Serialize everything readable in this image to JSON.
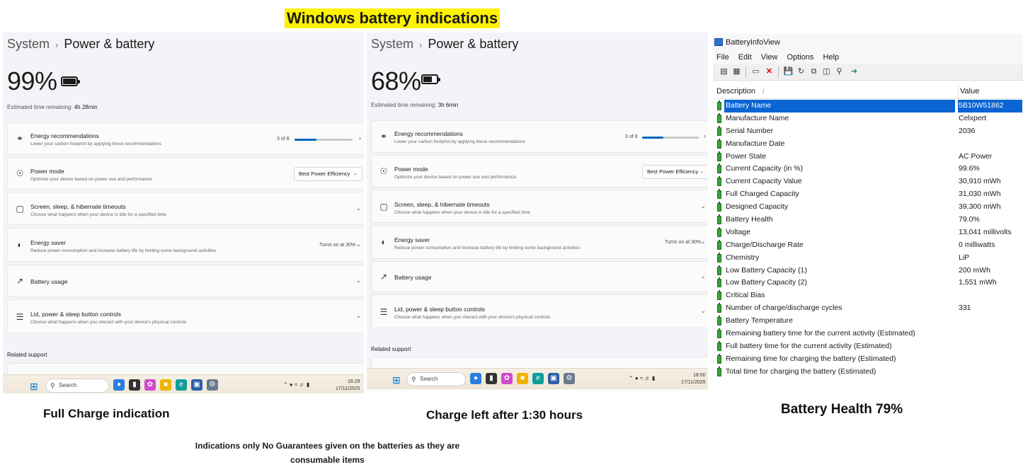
{
  "banner": "Windows battery indications",
  "panels": [
    {
      "breadcrumb_parent": "System",
      "breadcrumb_current": "Power & battery",
      "percentage": "99%",
      "battery_level": 0.99,
      "estimate_label": "Estimated time remaining:",
      "estimate_value": "4h 28min",
      "energy_title": "Energy recommendations",
      "energy_desc": "Lower your carbon footprint by applying these recommendations",
      "energy_count": "3 of 8",
      "energy_progress": 0.375,
      "power_mode_title": "Power mode",
      "power_mode_desc": "Optimize your device based on power use and performance",
      "power_mode_value": "Best Power Efficiency",
      "screen_title": "Screen, sleep, & hibernate timeouts",
      "screen_desc": "Choose what happens when your device is idle for a specified time",
      "saver_title": "Energy saver",
      "saver_desc": "Reduce power consumption and increase battery life by limiting some background activities",
      "saver_value": "Turns on at 30%",
      "usage_title": "Battery usage",
      "lid_title": "Lid, power & sleep button controls",
      "lid_desc": "Choose what happens when you interact with your device's physical controls",
      "related": "Related support",
      "search": "Search",
      "time": "16:29",
      "date": "17/11/2025"
    },
    {
      "breadcrumb_parent": "System",
      "breadcrumb_current": "Power & battery",
      "percentage": "68%",
      "battery_level": 0.68,
      "estimate_label": "Estimated time remaining:",
      "estimate_value": "3h 6min",
      "energy_title": "Energy recommendations",
      "energy_desc": "Lower your carbon footprint by applying these recommendations",
      "energy_count": "3 of 8",
      "energy_progress": 0.375,
      "power_mode_title": "Power mode",
      "power_mode_desc": "Optimize your device based on power use and performance",
      "power_mode_value": "Best Power Efficiency",
      "screen_title": "Screen, sleep, & hibernate timeouts",
      "screen_desc": "Choose what happens when your device is idle for a specified time",
      "saver_title": "Energy saver",
      "saver_desc": "Reduce power consumption and increase battery life by limiting some background activities",
      "saver_value": "Turns on at 30%",
      "usage_title": "Battery usage",
      "lid_title": "Lid, power & sleep button controls",
      "lid_desc": "Choose what happens when you interact with your device's physical controls",
      "related": "Related support",
      "search": "Search",
      "time": "18:00",
      "date": "17/11/2025"
    }
  ],
  "biv": {
    "title": "BatteryInfoView",
    "menu": [
      "File",
      "Edit",
      "View",
      "Options",
      "Help"
    ],
    "col_description": "Description",
    "col_value": "Value",
    "rows": [
      {
        "d": "Battery Name",
        "v": "5B10W51862"
      },
      {
        "d": "Manufacture Name",
        "v": "Celxpert"
      },
      {
        "d": "Serial Number",
        "v": " 2036"
      },
      {
        "d": "Manufacture Date",
        "v": ""
      },
      {
        "d": "Power State",
        "v": "AC Power"
      },
      {
        "d": "Current Capacity (in %)",
        "v": "99.6%"
      },
      {
        "d": "Current Capacity Value",
        "v": "30,910 mWh"
      },
      {
        "d": "Full Charged Capacity",
        "v": "31,030 mWh"
      },
      {
        "d": "Designed Capacity",
        "v": "39,300 mWh"
      },
      {
        "d": "Battery Health",
        "v": "79.0%"
      },
      {
        "d": "Voltage",
        "v": "13,041 millivolts"
      },
      {
        "d": "Charge/Discharge Rate",
        "v": "0 milliwatts"
      },
      {
        "d": "Chemistry",
        "v": "LiP"
      },
      {
        "d": "Low Battery Capacity (1)",
        "v": "200 mWh"
      },
      {
        "d": "Low Battery Capacity (2)",
        "v": "1,551 mWh"
      },
      {
        "d": "Critical Bias",
        "v": ""
      },
      {
        "d": "Number of charge/discharge cycles",
        "v": "331"
      },
      {
        "d": "Battery Temperature",
        "v": ""
      },
      {
        "d": "Remaining battery time for the current activity (Estimated)",
        "v": ""
      },
      {
        "d": "Full battery time for the current activity (Estimated)",
        "v": ""
      },
      {
        "d": "Remaining time for charging the battery (Estimated)",
        "v": ""
      },
      {
        "d": "Total  time for charging the battery (Estimated)",
        "v": ""
      }
    ]
  },
  "captions": {
    "full_charge": "Full Charge indication",
    "charge_left": "Charge left after 1:30 hours",
    "battery_health": "Battery Health 79%"
  },
  "note": "Indications only No Guarantees given on the batteries as they are consumable items",
  "colors": {
    "accent": "#0067c0",
    "banner": "#fff200",
    "selection": "#0a64d2",
    "battery_icon": "#3aa23a"
  }
}
